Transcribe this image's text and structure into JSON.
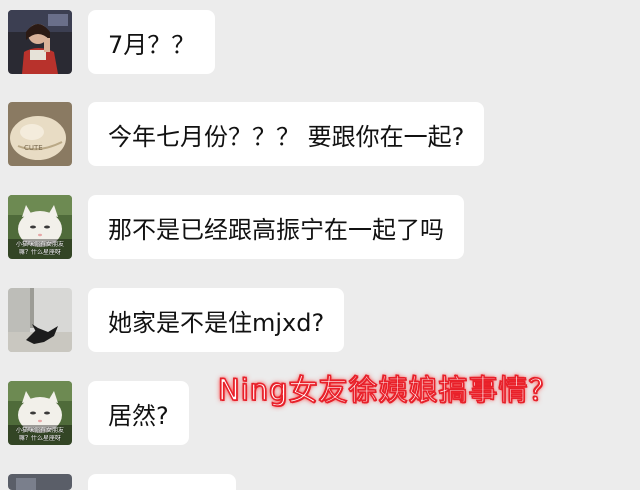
{
  "messages": [
    {
      "text": "7月？？",
      "avatar": "person-photo-avatar"
    },
    {
      "text": "今年七月份？？？ 要跟你在一起?",
      "avatar": "sack-photo-avatar"
    },
    {
      "text": "那不是已经跟高振宁在一起了吗",
      "avatar": "cat-meme-avatar",
      "avatar_caption_1": "小猫咪你有女朋友",
      "avatar_caption_2": "嘛？什么星座呀"
    },
    {
      "text": "她家是不是住mjxd?",
      "avatar": "cat-on-floor-avatar"
    },
    {
      "text": "居然?",
      "avatar": "cat-meme-avatar",
      "avatar_caption_1": "小猫咪你有女朋友",
      "avatar_caption_2": "嘛？什么星座呀"
    }
  ],
  "overlay_caption": "Ning女友徐姨娘搞事情？",
  "colors": {
    "background": "#ececec",
    "bubble": "#ffffff",
    "caption_stroke": "#e8202a"
  }
}
